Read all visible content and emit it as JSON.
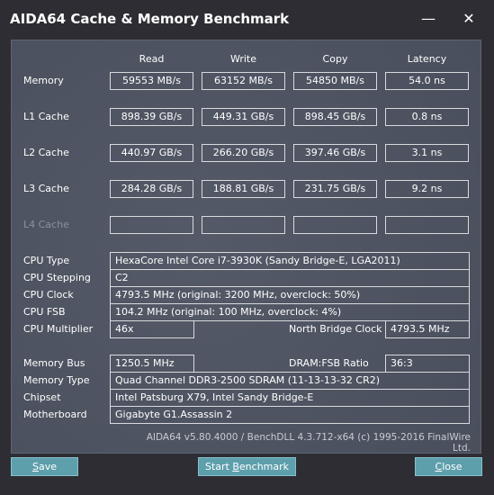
{
  "window": {
    "title": "AIDA64 Cache & Memory Benchmark",
    "minimize_glyph": "—",
    "close_glyph": "✕"
  },
  "columns": [
    "Read",
    "Write",
    "Copy",
    "Latency"
  ],
  "rows": [
    {
      "label": "Memory",
      "values": [
        "59553 MB/s",
        "63152 MB/s",
        "54850 MB/s",
        "54.0 ns"
      ]
    },
    {
      "label": "L1 Cache",
      "values": [
        "898.39 GB/s",
        "449.31 GB/s",
        "898.45 GB/s",
        "0.8 ns"
      ]
    },
    {
      "label": "L2 Cache",
      "values": [
        "440.97 GB/s",
        "266.20 GB/s",
        "397.46 GB/s",
        "3.1 ns"
      ]
    },
    {
      "label": "L3 Cache",
      "values": [
        "284.28 GB/s",
        "188.81 GB/s",
        "231.75 GB/s",
        "9.2 ns"
      ]
    },
    {
      "label": "L4 Cache",
      "values": [
        "",
        "",
        "",
        ""
      ]
    }
  ],
  "cpu": {
    "type_label": "CPU Type",
    "type_value": "HexaCore Intel Core i7-3930K  (Sandy Bridge-E, LGA2011)",
    "stepping_label": "CPU Stepping",
    "stepping_value": "C2",
    "clock_label": "CPU Clock",
    "clock_value": "4793.5 MHz  (original: 3200 MHz, overclock: 50%)",
    "fsb_label": "CPU FSB",
    "fsb_value": "104.2 MHz  (original: 100 MHz, overclock: 4%)",
    "multiplier_label": "CPU Multiplier",
    "multiplier_value": "46x",
    "nb_clock_label": "North Bridge Clock",
    "nb_clock_value": "4793.5 MHz"
  },
  "memory": {
    "bus_label": "Memory Bus",
    "bus_value": "1250.5 MHz",
    "ratio_label": "DRAM:FSB Ratio",
    "ratio_value": "36:3",
    "type_label": "Memory Type",
    "type_value": "Quad Channel DDR3-2500 SDRAM  (11-13-13-32 CR2)",
    "chipset_label": "Chipset",
    "chipset_value": "Intel Patsburg X79, Intel Sandy Bridge-E",
    "motherboard_label": "Motherboard",
    "motherboard_value": "Gigabyte G1.Assassin 2"
  },
  "footer": "AIDA64 v5.80.4000 / BenchDLL 4.3.712-x64  (c) 1995-2016 FinalWire Ltd.",
  "buttons": {
    "save_first": "S",
    "save_rest": "ave",
    "start_pre": "Start ",
    "start_first": "B",
    "start_rest": "enchmark",
    "close_first": "C",
    "close_rest": "lose"
  },
  "colors": {
    "window_bg": "#2d2d33",
    "panel_bg": "#4d5361",
    "button_bg": "#5e9fac"
  }
}
